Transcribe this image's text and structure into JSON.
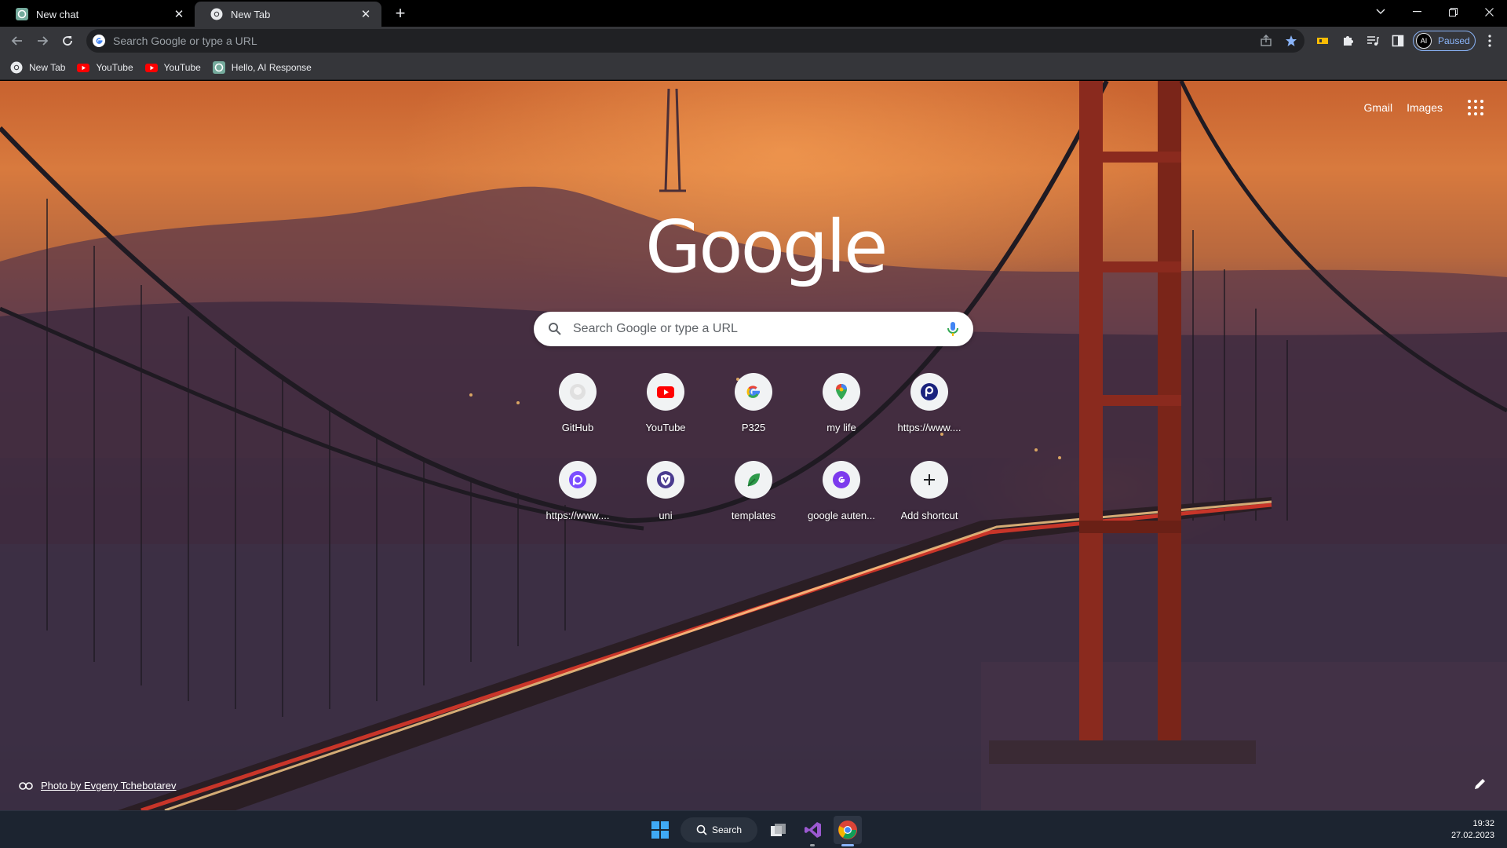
{
  "tabs": [
    {
      "title": "New chat",
      "icon": "chatgpt-icon",
      "active": false
    },
    {
      "title": "New Tab",
      "icon": "chrome-icon",
      "active": true
    }
  ],
  "window_controls": {
    "tab_search": "chevron-down-icon",
    "minimize": "minimize-icon",
    "restore": "restore-icon",
    "close": "close-icon"
  },
  "omnibox": {
    "placeholder": "Search Google or type a URL"
  },
  "profile": {
    "initials": "AI",
    "status": "Paused"
  },
  "bookmarks": [
    {
      "label": "New Tab",
      "icon": "chrome-icon"
    },
    {
      "label": "YouTube",
      "icon": "youtube-icon"
    },
    {
      "label": "YouTube",
      "icon": "youtube-icon"
    },
    {
      "label": "Hello, AI Response",
      "icon": "chatgpt-icon"
    }
  ],
  "ntp": {
    "links": {
      "gmail": "Gmail",
      "images": "Images"
    },
    "logo_text": "Google",
    "search_placeholder": "Search Google or type a URL",
    "shortcuts": [
      {
        "label": "GitHub",
        "icon": "github-icon"
      },
      {
        "label": "YouTube",
        "icon": "youtube-icon"
      },
      {
        "label": "P325",
        "icon": "google-g-icon"
      },
      {
        "label": "my life",
        "icon": "maps-pin-icon"
      },
      {
        "label": "https://www....",
        "icon": "p-circle-icon"
      },
      {
        "label": "https://www....",
        "icon": "d-circle-icon"
      },
      {
        "label": "uni",
        "icon": "shield-v-icon"
      },
      {
        "label": "templates",
        "icon": "leaf-icon"
      },
      {
        "label": "google auten...",
        "icon": "g-purple-icon"
      },
      {
        "label": "Add shortcut",
        "icon": "plus-icon"
      }
    ],
    "attribution": "Photo by Evgeny Tchebotarev"
  },
  "taskbar": {
    "search_label": "Search",
    "time": "19:32",
    "date": "27.02.2023"
  },
  "colors": {
    "tab_active": "#35363a",
    "toolbar": "#35363a",
    "accent_blue": "#8ab4f8",
    "taskbar": "#1c2430"
  }
}
